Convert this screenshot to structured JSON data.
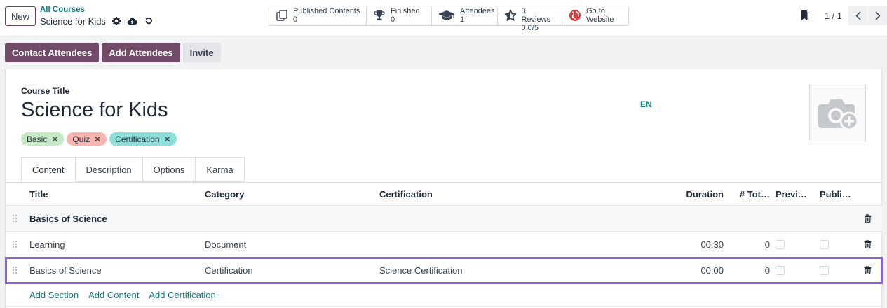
{
  "topbar": {
    "new_label": "New",
    "breadcrumb_parent": "All Courses",
    "breadcrumb_current": "Science for Kids"
  },
  "smart_buttons": [
    {
      "icon": "copy-icon",
      "label": "Published Contents",
      "value": "0"
    },
    {
      "icon": "trophy-icon",
      "label": "Finished",
      "value": "0"
    },
    {
      "icon": "graduation-cap-icon",
      "label": "Attendees",
      "value": "1"
    },
    {
      "icon": "star-icon",
      "label": "0 Reviews",
      "value": "0.0/5"
    },
    {
      "icon": "globe-icon",
      "label": "Go to",
      "value": "Website"
    }
  ],
  "pager": {
    "value": "1 / 1"
  },
  "actions": {
    "contact": "Contact Attendees",
    "add": "Add Attendees",
    "invite": "Invite"
  },
  "form": {
    "title_label": "Course Title",
    "title": "Science for Kids",
    "lang": "EN",
    "tags": [
      {
        "label": "Basic",
        "color": "#c6e8c4"
      },
      {
        "label": "Quiz",
        "color": "#f7b5b0"
      },
      {
        "label": "Certification",
        "color": "#8ddfd8"
      }
    ]
  },
  "tabs": [
    "Content",
    "Description",
    "Options",
    "Karma"
  ],
  "table": {
    "headers": {
      "title": "Title",
      "category": "Category",
      "certification": "Certification",
      "duration": "Duration",
      "total": "# Tot…",
      "preview": "Previ…",
      "published": "Publi…"
    },
    "section": "Basics of Science",
    "rows": [
      {
        "title": "Learning",
        "category": "Document",
        "certification": "",
        "duration": "00:30",
        "total": "0"
      },
      {
        "title": "Basics of Science",
        "category": "Certification",
        "certification": "Science Certification",
        "duration": "00:00",
        "total": "0"
      }
    ],
    "add_links": [
      "Add Section",
      "Add Content",
      "Add Certification"
    ]
  },
  "colors": {
    "brand": "#714b67",
    "link": "#0f7c86",
    "selection": "#8c5ed8"
  }
}
